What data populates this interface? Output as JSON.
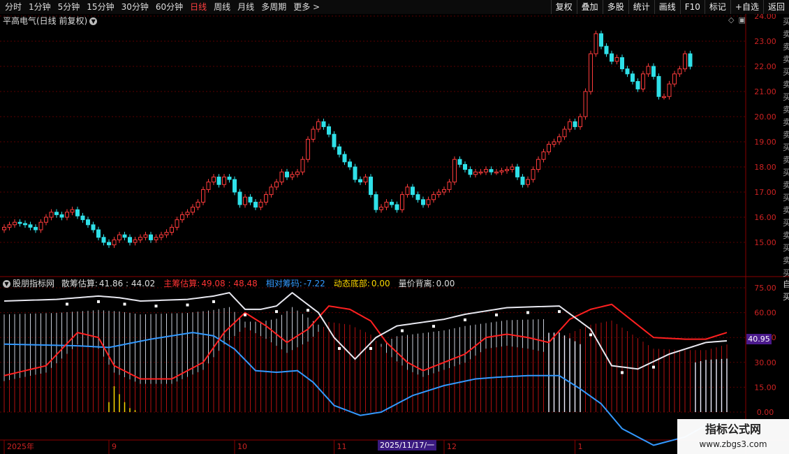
{
  "toolbar": {
    "left": [
      "分时",
      "1分钟",
      "5分钟",
      "15分钟",
      "30分钟",
      "60分钟",
      "日线",
      "周线",
      "月线",
      "多周期",
      "更多 >"
    ],
    "active": "日线",
    "right": [
      "复权",
      "叠加",
      "多股",
      "统计",
      "画线",
      "F10",
      "标记",
      "+自选",
      "返回"
    ]
  },
  "main": {
    "title": "平高电气(日线 前复权)",
    "y_ticks": [
      "24.00",
      "23.00",
      "22.00",
      "21.00",
      "20.00",
      "19.00",
      "18.00",
      "17.00",
      "16.00",
      "15.00"
    ],
    "y_values": [
      24,
      23,
      22,
      21,
      20,
      19,
      18,
      17,
      16,
      15
    ]
  },
  "indicator": {
    "name": "股朋指标网",
    "items": [
      {
        "label": "散筹估算:",
        "value": "41.86 : 44.02",
        "color": "#dddddd"
      },
      {
        "label": "主筹估算:",
        "value": "49.08 : 48.48",
        "color": "#ff3333"
      },
      {
        "label": "相对筹码:",
        "value": "-7.22",
        "color": "#3399ff"
      },
      {
        "label": "动态底部:",
        "value": "0.00",
        "color": "#ffd700"
      },
      {
        "label": "量价背离:",
        "value": "0.00",
        "color": "#dddddd"
      }
    ],
    "y_ticks": [
      "75.00",
      "60.00",
      "45.00",
      "30.00",
      "15.00",
      "0.00"
    ],
    "y_values": [
      75,
      60,
      45,
      30,
      15,
      0
    ],
    "marker": "40.95"
  },
  "time_axis": {
    "labels": [
      {
        "text": "2025年",
        "i": 0
      },
      {
        "text": "9",
        "i": 20
      },
      {
        "text": "10",
        "i": 44
      },
      {
        "text": "11",
        "i": 63
      },
      {
        "text": "12",
        "i": 84
      },
      {
        "text": "1",
        "i": 109
      }
    ],
    "cursor_date": "2025/11/17/一"
  },
  "side_text": "买卖卖卖买卖买卖卖卖买卖买卖买卖买卖买卖买卖",
  "side_text2": "自买",
  "watermark": {
    "line1": "指标公式网",
    "line2": "www.zbgs3.com"
  },
  "colors": {
    "up": "#ff3b3b",
    "down": "#2fe0e8",
    "white": "#e8e8f0",
    "red": "#ff2020",
    "blue": "#3399ff",
    "yellow": "#ffd700"
  },
  "chart_data": {
    "type": "candlestick",
    "closes": [
      15.6,
      15.7,
      15.8,
      15.75,
      15.7,
      15.6,
      15.5,
      15.8,
      16.0,
      16.2,
      16.1,
      16.0,
      16.2,
      16.3,
      16.05,
      15.9,
      15.7,
      15.5,
      15.2,
      15.0,
      14.9,
      15.1,
      15.3,
      15.2,
      15.0,
      15.1,
      15.2,
      15.3,
      15.1,
      15.2,
      15.3,
      15.4,
      15.6,
      15.9,
      16.1,
      16.2,
      16.4,
      16.6,
      17.1,
      17.4,
      17.6,
      17.3,
      17.6,
      17.5,
      17.0,
      16.5,
      16.8,
      16.6,
      16.4,
      16.6,
      16.9,
      17.2,
      17.4,
      17.8,
      17.6,
      17.7,
      17.8,
      18.3,
      19.1,
      19.5,
      19.8,
      19.6,
      19.3,
      18.8,
      18.5,
      18.2,
      18.0,
      17.5,
      17.4,
      17.6,
      16.9,
      16.3,
      16.4,
      16.6,
      16.5,
      16.3,
      16.9,
      17.2,
      16.9,
      16.7,
      16.5,
      16.7,
      16.9,
      17.0,
      17.1,
      17.4,
      18.3,
      18.1,
      17.9,
      17.7,
      17.8,
      17.8,
      17.9,
      17.8,
      17.8,
      17.85,
      17.9,
      18.0,
      17.6,
      17.3,
      17.5,
      17.9,
      18.3,
      18.6,
      18.9,
      19.0,
      19.2,
      19.5,
      19.8,
      19.6,
      20.0,
      21.0,
      22.5,
      23.3,
      22.8,
      22.5,
      22.2,
      22.35,
      21.9,
      21.7,
      21.4,
      21.1,
      21.7,
      22.0,
      21.6,
      20.8,
      20.8,
      21.3,
      21.7,
      21.9,
      22.5,
      22.0
    ]
  }
}
